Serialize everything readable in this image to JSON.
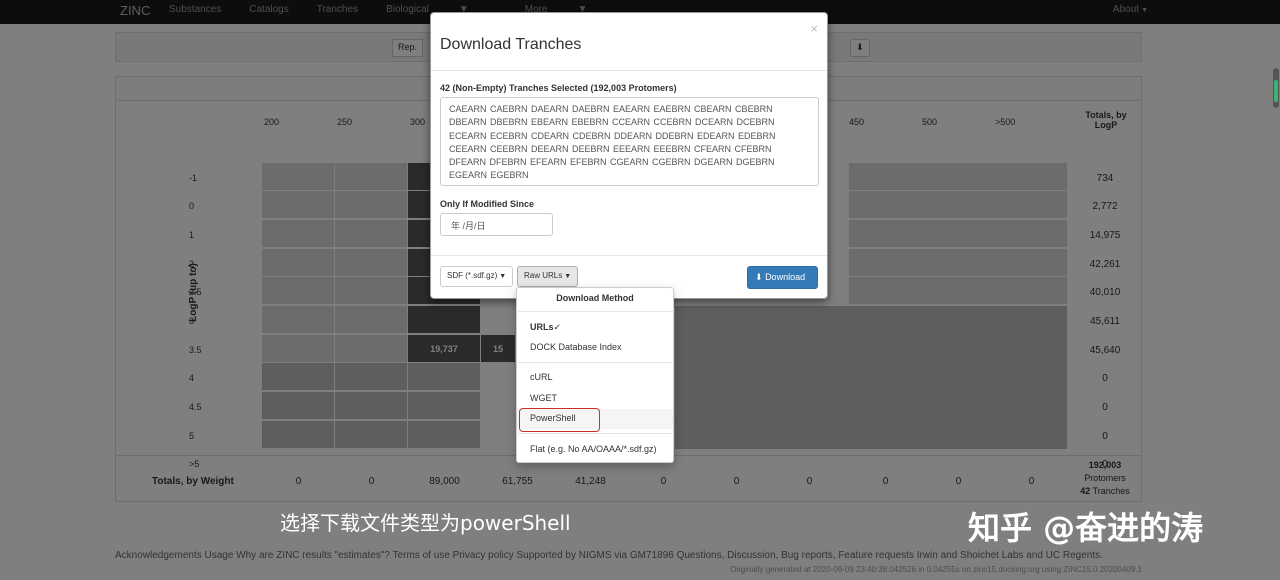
{
  "navbar": {
    "brand": "ZINC",
    "items": [
      "Substances",
      "Catalogs",
      "Tranches",
      "Biological",
      "More"
    ],
    "about": "About"
  },
  "toolbar": {
    "rep": "Rep."
  },
  "grid": {
    "y_axis_label": "LogP (up to)",
    "columns": [
      "200",
      "250",
      "300",
      "",
      "",
      "",
      "",
      "",
      "450",
      "500",
      ">500"
    ],
    "totals_header": "Totals, by LogP",
    "rows": [
      {
        "label": "-1",
        "total": "734"
      },
      {
        "label": "0",
        "total": "2,772"
      },
      {
        "label": "1",
        "total": "14,975"
      },
      {
        "label": "2",
        "total": "42,261"
      },
      {
        "label": "2.5",
        "total": "40,010"
      },
      {
        "label": "3",
        "total": "45,611"
      },
      {
        "label": "3.5",
        "total": "45,640"
      },
      {
        "label": "4",
        "total": "0"
      },
      {
        "label": "4.5",
        "total": "0"
      },
      {
        "label": "5",
        "total": "0"
      },
      {
        "label": ">5",
        "total": "0"
      }
    ],
    "visible_cells": {
      "c19737": "19,737",
      "c15": "15"
    },
    "totals_row": {
      "label": "Totals, by Weight",
      "values": [
        "0",
        "0",
        "89,000",
        "61,755",
        "41,248",
        "0",
        "0",
        "0",
        "0",
        "0",
        "0"
      ],
      "grand_total": "192,003",
      "protomers": "Protomers",
      "tranche_count": "42",
      "tranches": "Tranches"
    }
  },
  "modal": {
    "title": "Download Tranches",
    "close": "×",
    "selected_label": "42 (Non-Empty) Tranches Selected (192,003 Protomers)",
    "tranches_text": "CAEARN CAEBRN DAEARN DAEBRN EAEARN EAEBRN CBEARN CBEBRN DBEARN DBEBRN EBEARN EBEBRN CCEARN CCEBRN DCEARN DCEBRN ECEARN ECEBRN CDEARN CDEBRN DDEARN DDEBRN EDEARN EDEBRN CEEARN CEEBRN DEEARN DEEBRN EEEARN EEEBRN CFEARN CFEBRN DFEARN DFEBRN EFEARN EFEBRN CGEARN CGEBRN DGEARN DGEBRN EGEARN EGEBRN",
    "since_label": "Only If Modified Since",
    "date_placeholder": "年 /月/日",
    "format_button": "SDF (*.sdf.gz)",
    "method_button": "Raw URLs",
    "download_button": "Download",
    "download_icon": "download-icon"
  },
  "dropdown": {
    "header": "Download Method",
    "items": [
      {
        "label": "URLs✓"
      },
      {
        "label": "DOCK Database Index"
      },
      {
        "label": "cURL"
      },
      {
        "label": "WGET"
      },
      {
        "label": "PowerShell"
      },
      {
        "label": "Flat (e.g. No AA/OAAA/*.sdf.gz)"
      }
    ]
  },
  "footer": {
    "ack": "Acknowledgements Usage Why are ZINC results \"estimates\"? Terms of use Privacy policy Supported by NIGMS via GM71896 Questions, Discussion, Bug reports, Feature requests Irwin and Shoichet Labs and UC Regents.",
    "generated": "Originally generated at 2020-09-09 23:40:38.042526 in 0.04255s on zinc15.docking.org using ZINC15.0.20200409.1"
  },
  "overlay": {
    "caption": "选择下载文件类型为powerShell",
    "watermark": "知乎 @奋进的涛"
  },
  "colors": {
    "primary": "#337ab7",
    "highlight": "#c9302c"
  }
}
